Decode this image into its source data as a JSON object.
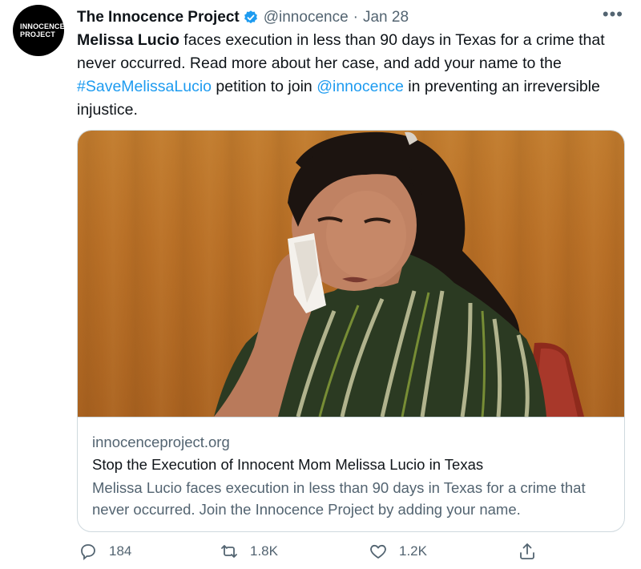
{
  "author": {
    "avatar_text_line1": "INNOCENCE",
    "avatar_text_line2": "PROJECT",
    "name": "The Innocence Project",
    "handle": "@innocence",
    "separator": "·",
    "date": "Jan 28"
  },
  "tweet": {
    "bold_lead": "Melissa Lucio",
    "text_1": " faces execution in less than 90 days in Texas for a crime that never occurred. Read more about her case, and add your name to the ",
    "hashtag": "#SaveMelissaLucio",
    "text_2": " petition to join ",
    "mention": "@innocence",
    "text_3": " in preventing an irreversible injustice."
  },
  "card": {
    "domain": "innocenceproject.org",
    "title": "Stop the Execution of Innocent Mom Melissa Lucio in Texas",
    "description": "Melissa Lucio faces execution in less than 90 days in Texas for a crime that never occurred. Join the Innocence Project by adding your name."
  },
  "actions": {
    "reply_count": "184",
    "retweet_count": "1.8K",
    "like_count": "1.2K"
  },
  "colors": {
    "link": "#1d9bf0",
    "secondary_text": "#536471",
    "verified": "#1d9bf0"
  },
  "icons": [
    "more-icon",
    "verified-badge-icon",
    "reply-icon",
    "retweet-icon",
    "like-icon",
    "share-icon"
  ]
}
